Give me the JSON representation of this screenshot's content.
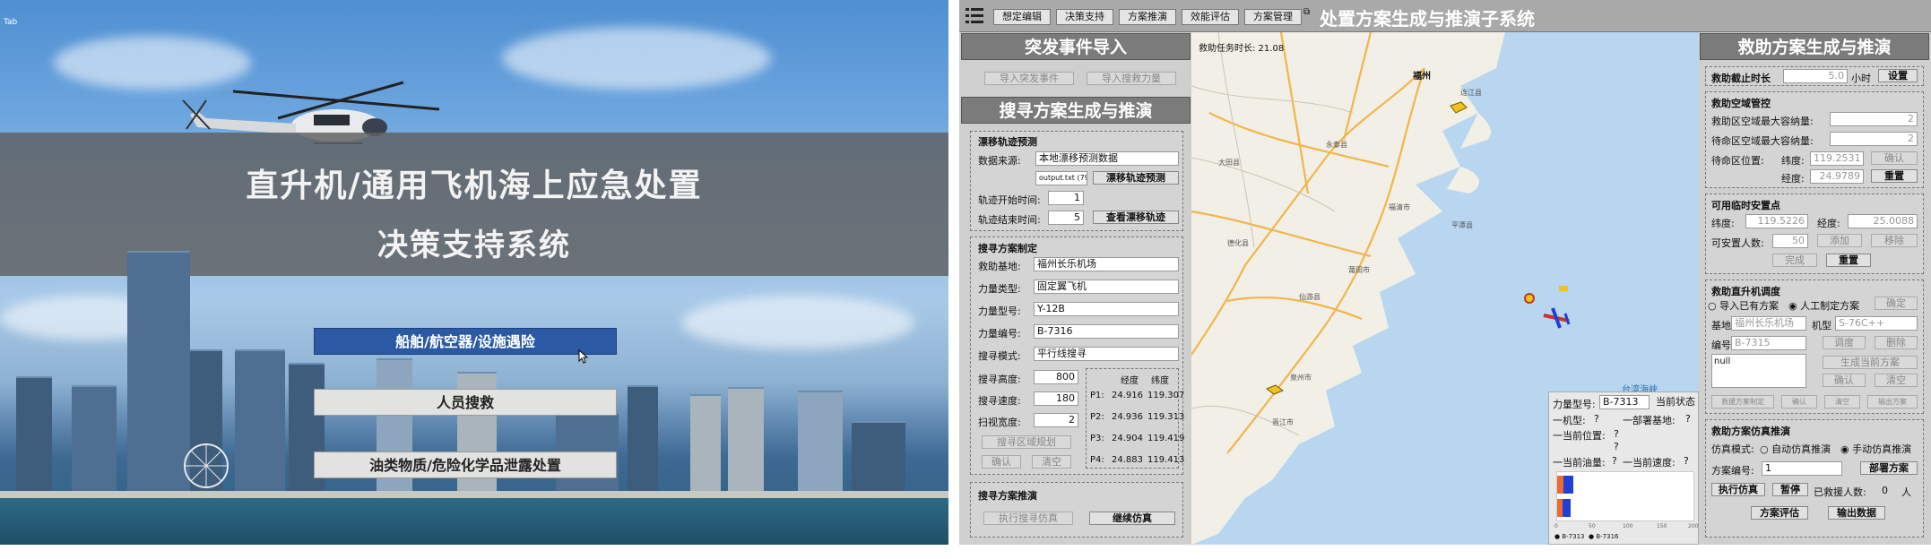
{
  "left": {
    "title_line1": "直升机/通用飞机海上应急处置",
    "title_line2": "决策支持系统",
    "corner_text": "Tab",
    "options": [
      "船舶/航空器/设施遇险",
      "人员搜救",
      "油类物质/危险化学品泄露处置"
    ]
  },
  "app": {
    "title": "处置方案生成与推演子系统",
    "menu": [
      "想定编辑",
      "决策支持",
      "方案推演",
      "效能评估",
      "方案管理"
    ]
  },
  "incident": {
    "header": "突发事件导入",
    "import_event": "导入突发事件",
    "import_force": "导入搜救力量"
  },
  "search": {
    "header": "搜寻方案生成与推演",
    "drift": {
      "title": "漂移轨迹预测",
      "source_label": "数据来源:",
      "source_value": "本地漂移预测数据",
      "file_value": "output.txt (798,878",
      "predict_btn": "漂移轨迹预测",
      "start_label": "轨迹开始时间:",
      "start_value": "1",
      "end_label": "轨迹结束时间:",
      "end_value": "5",
      "view_btn": "查看漂移轨迹"
    },
    "plan": {
      "title": "搜寻方案制定",
      "base_label": "救助基地:",
      "base_value": "福州长乐机场",
      "type_label": "力量类型:",
      "type_value": "固定翼飞机",
      "model_label": "力量型号:",
      "model_value": "Y-12B",
      "id_label": "力量编号:",
      "id_value": "B-7316",
      "mode_label": "搜寻模式:",
      "mode_value": "平行线搜寻",
      "height_label": "搜寻高度:",
      "height_value": "800",
      "speed_label": "搜寻速度:",
      "speed_value": "180",
      "width_label": "扫视宽度:",
      "width_value": "2",
      "plan_btn": "搜寻区域规划",
      "confirm_btn": "确认",
      "clear_btn": "清空",
      "coord_head_lat": "经度",
      "coord_head_lon": "纬度",
      "points": [
        {
          "p": "P1:",
          "a": "24.916",
          "b": "119.307"
        },
        {
          "p": "P2:",
          "a": "24.936",
          "b": "119.313"
        },
        {
          "p": "P3:",
          "a": "24.904",
          "b": "119.419"
        },
        {
          "p": "P4:",
          "a": "24.883",
          "b": "119.413"
        }
      ]
    },
    "sim": {
      "title": "搜寻方案推演",
      "exec_btn": "执行搜寻仿真",
      "continue_btn": "继续仿真"
    }
  },
  "map": {
    "task_time": "救助任务时长: 21.08",
    "strait_label": "台湾海峡",
    "city_label": "福州",
    "places": [
      "连江县",
      "大田县",
      "永泰县",
      "福清市",
      "莆田市",
      "仙游县",
      "平潭县",
      "泉州市",
      "晋江市",
      "德化县"
    ],
    "info": {
      "model_label": "力量型号:",
      "model_value": "B-7313",
      "status_btn": "当前状态",
      "fleet_label": "一机型:",
      "fleet_value": "?",
      "base_label": "一部署基地:",
      "base_value": "?",
      "pos_label": "一当前位置:",
      "pos_value": "?",
      "extra_value": "?",
      "fuel_label": "一当前油量:",
      "fuel_value": "?",
      "speed_label": "一当前速度:",
      "speed_value": "?",
      "legend": [
        "B-7313",
        "B-7316"
      ],
      "ticks": [
        "0",
        "50",
        "100",
        "150",
        "200"
      ],
      "fuel_fraction": [
        0.12,
        0.1
      ]
    }
  },
  "rescue": {
    "header": "救助方案生成与推演",
    "deadline_label": "救助截止时长",
    "deadline_value": "5.0",
    "deadline_unit": "小时",
    "set_btn": "设置",
    "airspace": {
      "title": "救助空域管控",
      "cap1_label": "救助区空域最大容纳量:",
      "cap1_value": "2",
      "cap2_label": "待命区空域最大容纳量:",
      "cap2_value": "2",
      "pos_label": "待命区位置:",
      "lon_label": "纬度:",
      "lon_value": "119.2531",
      "confirm_btn": "确认",
      "lat_label": "经度:",
      "lat_value": "24.9789",
      "reset_btn": "重置"
    },
    "temp": {
      "title": "可用临时安置点",
      "lat_label": "纬度:",
      "lat_value": "119.5226",
      "lon_label": "经度:",
      "lon_value": "25.0088",
      "people_label": "可安置人数:",
      "people_value": "50",
      "add_btn": "添加",
      "remove_btn": "移除",
      "done_btn": "完成",
      "reset_btn": "重置"
    },
    "heli": {
      "title": "救助直升机调度",
      "opt1": "导入已有方案",
      "opt2": "人工制定方案",
      "confirm_btn": "确定",
      "base_label": "基地",
      "base_value": "福州长乐机场",
      "model_label": "机型",
      "model_value": "S-76C++",
      "id_label": "编号",
      "id_value": "B-7315",
      "dispatch_btn": "调度",
      "delete_btn": "删除",
      "text_value": "null",
      "gen_btn": "生成当前方案",
      "confirm2_btn": "确认",
      "clear_btn": "清空",
      "sub_btns": [
        "救援方案制定",
        "确认",
        "清空",
        "输出方案"
      ]
    },
    "simu": {
      "title": "救助方案仿真推演",
      "mode_label": "仿真模式:",
      "auto": "自动仿真推演",
      "manual": "手动仿真推演",
      "plan_label": "方案编号:",
      "plan_value": "1",
      "deploy_btn": "部署方案",
      "exec_btn": "执行仿真",
      "pause_btn": "暂停",
      "rescued_label": "已救援人数:",
      "rescued_value": "0",
      "rescued_unit": "人",
      "eval_btn": "方案评估",
      "output_btn": "输出数据"
    }
  },
  "colors": {
    "band": "#5f5f5f",
    "selected": "#2b59a3",
    "header": "#7b7b7b",
    "sea": "#b8d6f0",
    "land": "#f2efe6",
    "road": "#f2b64a"
  }
}
